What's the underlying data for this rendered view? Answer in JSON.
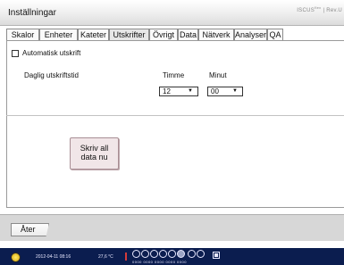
{
  "window": {
    "title": "Inställningar",
    "logo_text": "ISCUS",
    "logo_sup": "flex",
    "logo_rev": "| Rev.U"
  },
  "tabs": [
    {
      "label": "Skalor"
    },
    {
      "label": "Enheter"
    },
    {
      "label": "Kateter"
    },
    {
      "label": "Utskrifter",
      "active": true
    },
    {
      "label": "Övrigt"
    },
    {
      "label": "Data"
    },
    {
      "label": "Nätverk"
    },
    {
      "label": "Analyser"
    },
    {
      "label": "QA"
    }
  ],
  "print": {
    "auto_print_label": "Automatisk utskrift",
    "auto_print_checked": false,
    "daily_time_label": "Daglig utskriftstid",
    "hour_label": "Timme",
    "minute_label": "Minut",
    "hour_value": "12",
    "minute_value": "00"
  },
  "actions": {
    "write_all_line1": "Skriv all",
    "write_all_line2": "data nu",
    "back_label": "Åter"
  },
  "statusbar": {
    "datetime": "2012-04-11 08:16",
    "temperature": "27,6 °C",
    "dots": "0000 0000 0000 0000 0000"
  },
  "colors": {
    "statusbar_bg": "#0b1d4f",
    "action_button_bg": "#f1e6e8"
  },
  "icons": [
    "power-icon",
    "network-icon"
  ]
}
